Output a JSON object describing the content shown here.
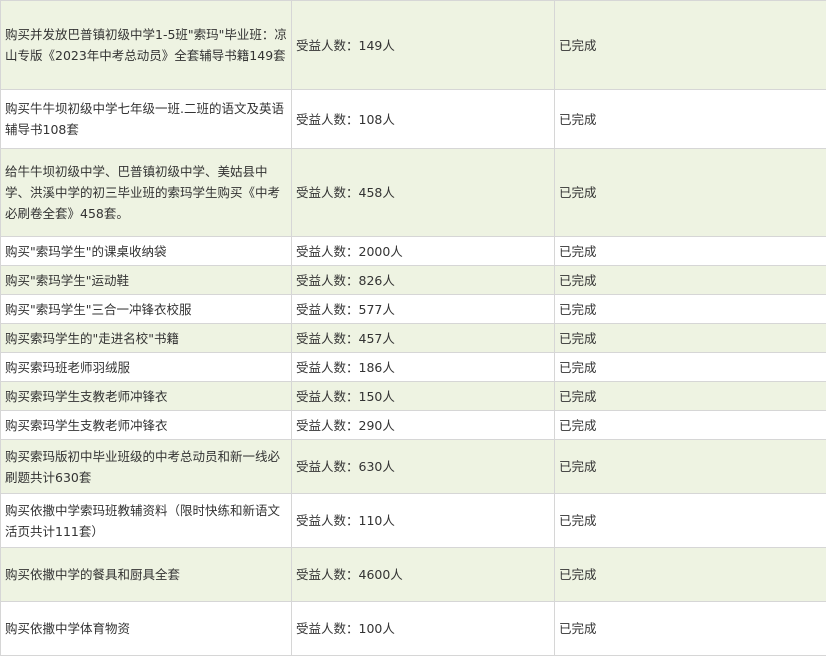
{
  "table": {
    "rows": [
      {
        "item": "购买并发放巴普镇初级中学1-5班\"索玛\"毕业班：凉山专版《2023年中考总动员》全套辅导书籍149套",
        "beneficiaries": "受益人数：149人",
        "status": "已完成"
      },
      {
        "item": "购买牛牛坝初级中学七年级一班.二班的语文及英语辅导书108套",
        "beneficiaries": "受益人数：108人",
        "status": "已完成"
      },
      {
        "item": "给牛牛坝初级中学、巴普镇初级中学、美姑县中学、洪溪中学的初三毕业班的索玛学生购买《中考必刷卷全套》458套。",
        "beneficiaries": "受益人数：458人",
        "status": "已完成"
      },
      {
        "item": "购买\"索玛学生\"的课桌收纳袋",
        "beneficiaries": "受益人数：2000人",
        "status": "已完成"
      },
      {
        "item": "购买\"索玛学生\"运动鞋",
        "beneficiaries": "受益人数：826人",
        "status": "已完成"
      },
      {
        "item": "购买\"索玛学生\"三合一冲锋衣校服",
        "beneficiaries": "受益人数：577人",
        "status": "已完成"
      },
      {
        "item": "购买索玛学生的\"走进名校\"书籍",
        "beneficiaries": "受益人数：457人",
        "status": "已完成"
      },
      {
        "item": "购买索玛班老师羽绒服",
        "beneficiaries": "受益人数：186人",
        "status": "已完成"
      },
      {
        "item": "购买索玛学生支教老师冲锋衣",
        "beneficiaries": "受益人数：150人",
        "status": "已完成"
      },
      {
        "item": "购买索玛学生支教老师冲锋衣",
        "beneficiaries": "受益人数：290人",
        "status": "已完成"
      },
      {
        "item": "购买索玛版初中毕业班级的中考总动员和新一线必刷题共计630套",
        "beneficiaries": "受益人数：630人",
        "status": "已完成"
      },
      {
        "item": "购买依撒中学索玛班教辅资料（限时快练和新语文活页共计111套）",
        "beneficiaries": "受益人数：110人",
        "status": "已完成"
      },
      {
        "item": "购买依撒中学的餐具和厨具全套",
        "beneficiaries": "受益人数：4600人",
        "status": "已完成"
      },
      {
        "item": "购买依撒中学体育物资",
        "beneficiaries": "受益人数：100人",
        "status": "已完成"
      }
    ]
  }
}
